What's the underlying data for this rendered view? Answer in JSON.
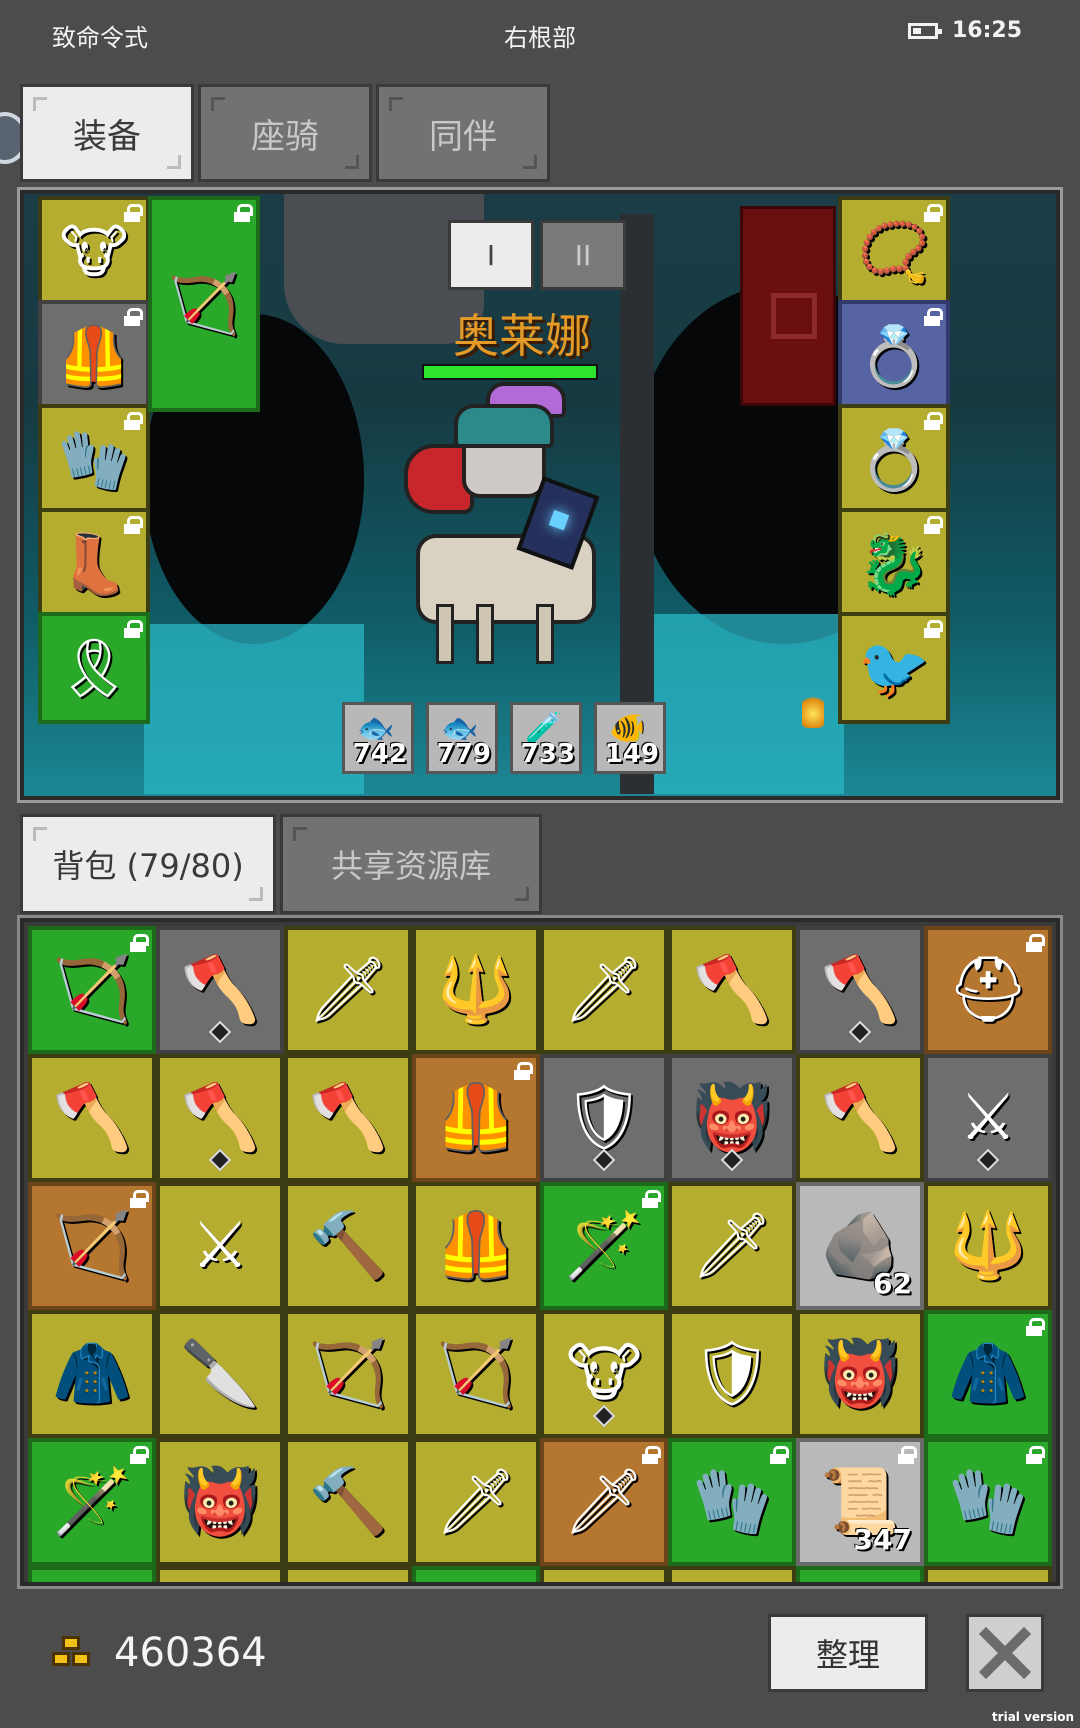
{
  "status_bar": {
    "left": "致命令式",
    "center": "右根部",
    "time": "16:25"
  },
  "top_tabs": [
    {
      "label": "装备",
      "active": true
    },
    {
      "label": "座骑",
      "active": false
    },
    {
      "label": "同伴",
      "active": false
    }
  ],
  "scene": {
    "loadout_tabs": [
      "I",
      "II"
    ],
    "character_name": "奥莱娜",
    "health_fraction": 1.0,
    "quick_slots": [
      {
        "count": "742",
        "icon": "blue-fish-icon"
      },
      {
        "count": "779",
        "icon": "blue-fish-icon"
      },
      {
        "count": "733",
        "icon": "potion-icon"
      },
      {
        "count": "149",
        "icon": "cooked-fish-icon"
      }
    ],
    "left_slots": [
      {
        "name": "helmet-slot",
        "icon": "horned-helmet-icon",
        "color": "yellow",
        "locked": true
      },
      {
        "name": "armor-slot",
        "icon": "armor-icon",
        "color": "gray",
        "locked": true
      },
      {
        "name": "gloves-slot",
        "icon": "gauntlet-icon",
        "color": "yellow",
        "locked": true
      },
      {
        "name": "boots-slot",
        "icon": "boots-icon",
        "color": "yellow",
        "locked": true
      },
      {
        "name": "belt-slot",
        "icon": "belt-icon",
        "color": "green",
        "locked": true
      }
    ],
    "weapon_slot": {
      "icon": "bow-icon",
      "color": "green",
      "locked": true
    },
    "right_slots": [
      {
        "name": "amulet-slot",
        "icon": "amulet-icon",
        "color": "yellow",
        "locked": true
      },
      {
        "name": "ring-slot-1",
        "icon": "emerald-ring-icon",
        "color": "blue",
        "locked": true
      },
      {
        "name": "ring-slot-2",
        "icon": "emerald-ring-icon",
        "color": "yellow",
        "locked": true
      },
      {
        "name": "pet-slot",
        "icon": "red-dragon-icon",
        "color": "yellow",
        "locked": true
      },
      {
        "name": "companion-slot",
        "icon": "bird-icon",
        "color": "yellow",
        "locked": true
      }
    ]
  },
  "bag_tabs": [
    {
      "label": "背包 (79/80)",
      "active": true
    },
    {
      "label": "共享资源库",
      "active": false
    }
  ],
  "inventory": [
    {
      "icon": "bow-icon",
      "color": "green",
      "locked": true
    },
    {
      "icon": "axe-icon",
      "color": "gray",
      "gem": true
    },
    {
      "icon": "spear-icon",
      "color": "yellow"
    },
    {
      "icon": "mace-icon",
      "color": "yellow"
    },
    {
      "icon": "dagger-icon",
      "color": "yellow"
    },
    {
      "icon": "double-axe-icon",
      "color": "yellow"
    },
    {
      "icon": "double-axe-icon",
      "color": "gray",
      "gem": true
    },
    {
      "icon": "helmet-icon",
      "color": "orange",
      "locked": true
    },
    {
      "icon": "axe-icon",
      "color": "yellow"
    },
    {
      "icon": "double-axe-icon",
      "color": "yellow",
      "gem": true
    },
    {
      "icon": "axe-icon",
      "color": "yellow"
    },
    {
      "icon": "armor-icon",
      "color": "orange",
      "locked": true
    },
    {
      "icon": "red-shield-icon",
      "color": "gray",
      "gem": true
    },
    {
      "icon": "demon-armor-icon",
      "color": "gray",
      "gem": true
    },
    {
      "icon": "axe-icon",
      "color": "yellow"
    },
    {
      "icon": "sword-icon",
      "color": "gray",
      "gem": true
    },
    {
      "icon": "bow-icon",
      "color": "orange",
      "locked": true
    },
    {
      "icon": "sword-icon",
      "color": "yellow"
    },
    {
      "icon": "hammer-icon",
      "color": "yellow"
    },
    {
      "icon": "chest-armor-icon",
      "color": "yellow"
    },
    {
      "icon": "staff-icon",
      "color": "green",
      "locked": true
    },
    {
      "icon": "spear-icon",
      "color": "yellow"
    },
    {
      "icon": "ore-icon",
      "color": "light",
      "count": "62"
    },
    {
      "icon": "trident-icon",
      "color": "yellow"
    },
    {
      "icon": "coil-armor-icon",
      "color": "yellow"
    },
    {
      "icon": "knife-icon",
      "color": "yellow"
    },
    {
      "icon": "bow-icon",
      "color": "yellow"
    },
    {
      "icon": "bow-icon",
      "color": "yellow"
    },
    {
      "icon": "horned-helmet-icon",
      "color": "yellow",
      "gem": true
    },
    {
      "icon": "shield-icon",
      "color": "yellow"
    },
    {
      "icon": "demon-armor-icon",
      "color": "yellow"
    },
    {
      "icon": "dark-armor-icon",
      "color": "green",
      "locked": true
    },
    {
      "icon": "staff-icon",
      "color": "green",
      "locked": true
    },
    {
      "icon": "demon-armor-icon",
      "color": "yellow"
    },
    {
      "icon": "hammer-icon",
      "color": "yellow"
    },
    {
      "icon": "spear-icon",
      "color": "yellow"
    },
    {
      "icon": "golden-sword-icon",
      "color": "orange",
      "locked": true
    },
    {
      "icon": "crystal-gauntlet-icon",
      "color": "green",
      "locked": true
    },
    {
      "icon": "scroll-icon",
      "color": "light",
      "locked": true,
      "count": "347"
    },
    {
      "icon": "crystal-gauntlet-icon",
      "color": "green",
      "locked": true
    }
  ],
  "footer": {
    "gold": "460364",
    "sort_label": "整理",
    "watermark": "trial version"
  }
}
